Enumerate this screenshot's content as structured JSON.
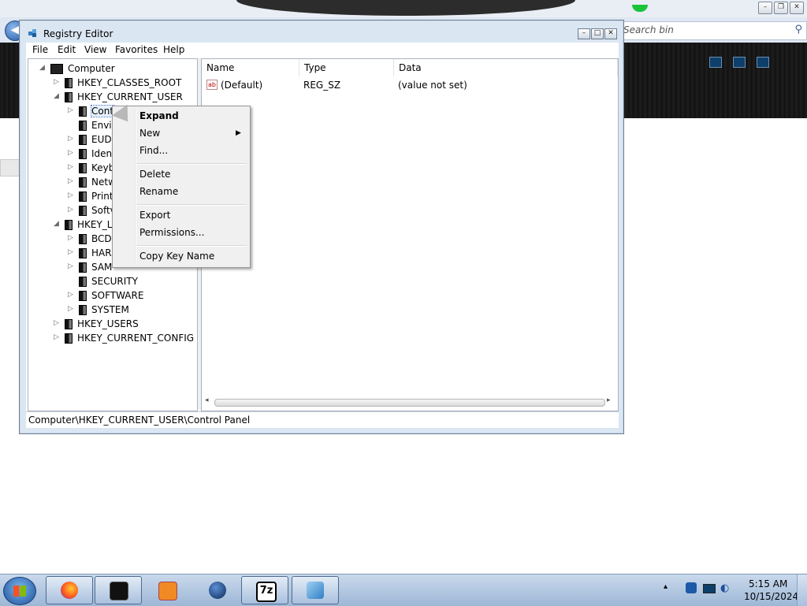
{
  "background": {
    "search_placeholder": "Search bin",
    "accent_dark": "#1a1a1a",
    "accent_green": "#19c43a"
  },
  "window": {
    "title": "Registry Editor",
    "menu": [
      "File",
      "Edit",
      "View",
      "Favorites",
      "Help"
    ]
  },
  "tree": {
    "nodes": [
      {
        "label": "Computer",
        "level": 0,
        "expander": "expanded"
      },
      {
        "label": "HKEY_CLASSES_ROOT",
        "level": 1,
        "expander": "collapsed"
      },
      {
        "label": "HKEY_CURRENT_USER",
        "level": 1,
        "expander": "expanded"
      },
      {
        "label": "Control Panel",
        "level": 2,
        "expander": "collapsed",
        "selected": true,
        "visible_text": "Cont"
      },
      {
        "label": "Envir",
        "level": 2,
        "expander": "none"
      },
      {
        "label": "EUDC",
        "level": 2,
        "expander": "collapsed"
      },
      {
        "label": "Ident",
        "level": 2,
        "expander": "collapsed"
      },
      {
        "label": "Keyb",
        "level": 2,
        "expander": "collapsed"
      },
      {
        "label": "Netw",
        "level": 2,
        "expander": "collapsed"
      },
      {
        "label": "Print",
        "level": 2,
        "expander": "collapsed"
      },
      {
        "label": "Softv",
        "level": 2,
        "expander": "collapsed"
      },
      {
        "label": "HKEY_LO",
        "level": 1,
        "expander": "expanded"
      },
      {
        "label": "BCDC",
        "level": 2,
        "expander": "collapsed"
      },
      {
        "label": "HAR",
        "level": 2,
        "expander": "collapsed"
      },
      {
        "label": "SAM",
        "level": 2,
        "expander": "collapsed"
      },
      {
        "label": "SECURITY",
        "level": 2,
        "expander": "none"
      },
      {
        "label": "SOFTWARE",
        "level": 2,
        "expander": "collapsed"
      },
      {
        "label": "SYSTEM",
        "level": 2,
        "expander": "collapsed"
      },
      {
        "label": "HKEY_USERS",
        "level": 1,
        "expander": "collapsed"
      },
      {
        "label": "HKEY_CURRENT_CONFIG",
        "level": 1,
        "expander": "collapsed"
      }
    ]
  },
  "values": {
    "columns": [
      "Name",
      "Type",
      "Data"
    ],
    "rows": [
      {
        "name": "(Default)",
        "type": "REG_SZ",
        "data": "(value not set)",
        "icon": "string-value-icon"
      }
    ]
  },
  "context_menu": {
    "items": [
      {
        "label": "Expand",
        "bold": true
      },
      {
        "label": "New",
        "submenu": true
      },
      {
        "label": "Find..."
      },
      {
        "label": "Delete"
      },
      {
        "label": "Rename"
      },
      {
        "label": "Export"
      },
      {
        "label": "Permissions..."
      },
      {
        "label": "Copy Key Name"
      }
    ]
  },
  "status_bar": {
    "path": "Computer\\HKEY_CURRENT_USER\\Control Panel"
  },
  "taskbar": {
    "apps": [
      "firefox-icon",
      "terminal-icon",
      "media-player-icon",
      "globe-icon",
      "7zip-icon",
      "registry-editor-icon"
    ],
    "seven_zip_label": "7z",
    "clock_time": "5:15 AM",
    "clock_date": "10/15/2024"
  }
}
